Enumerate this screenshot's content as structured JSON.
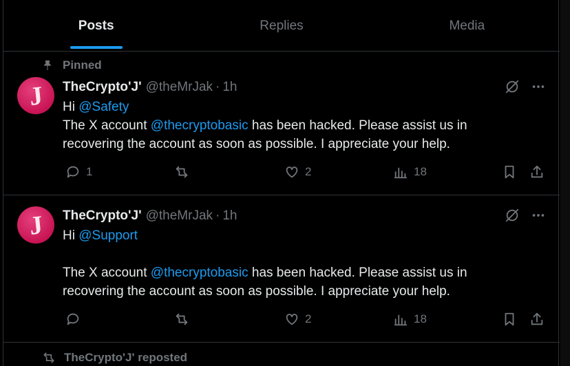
{
  "tabs": [
    {
      "label": "Posts",
      "active": true
    },
    {
      "label": "Replies",
      "active": false
    },
    {
      "label": "Media",
      "active": false
    }
  ],
  "colors": {
    "accent": "#1d9bf0",
    "muted": "#71767b",
    "text": "#e7e9ea",
    "border": "#2f3336",
    "avatar": "#c81454"
  },
  "posts": [
    {
      "pinned_label": "Pinned",
      "avatar_letter": "J",
      "name": "TheCrypto'J'",
      "handle": "@theMrJak",
      "separator": "·",
      "time": "1h",
      "line1_prefix": "Hi ",
      "line1_mention": "@Safety",
      "line2_prefix": "The X account ",
      "line2_mention": "@thecryptobasic",
      "line2_suffix": " has been hacked. Please assist us in recovering the account as soon as possible. I appreciate your help.",
      "replies": "1",
      "reposts": "",
      "likes": "2",
      "views": "18",
      "icons": [
        "pin-icon",
        "grok-icon",
        "more-icon",
        "reply-icon",
        "repost-icon",
        "like-icon",
        "views-icon",
        "bookmark-icon",
        "share-icon"
      ]
    },
    {
      "avatar_letter": "J",
      "name": "TheCrypto'J'",
      "handle": "@theMrJak",
      "separator": "·",
      "time": "1h",
      "line1_prefix": "Hi ",
      "line1_mention": "@Support",
      "line2_prefix": "The X account ",
      "line2_mention": "@thecryptobasic",
      "line2_suffix": " has been hacked. Please assist us in recovering the account as soon as possible. I appreciate your help.",
      "replies": "",
      "reposts": "",
      "likes": "2",
      "views": "18"
    }
  ],
  "repost_notice": "TheCrypto'J' reposted"
}
